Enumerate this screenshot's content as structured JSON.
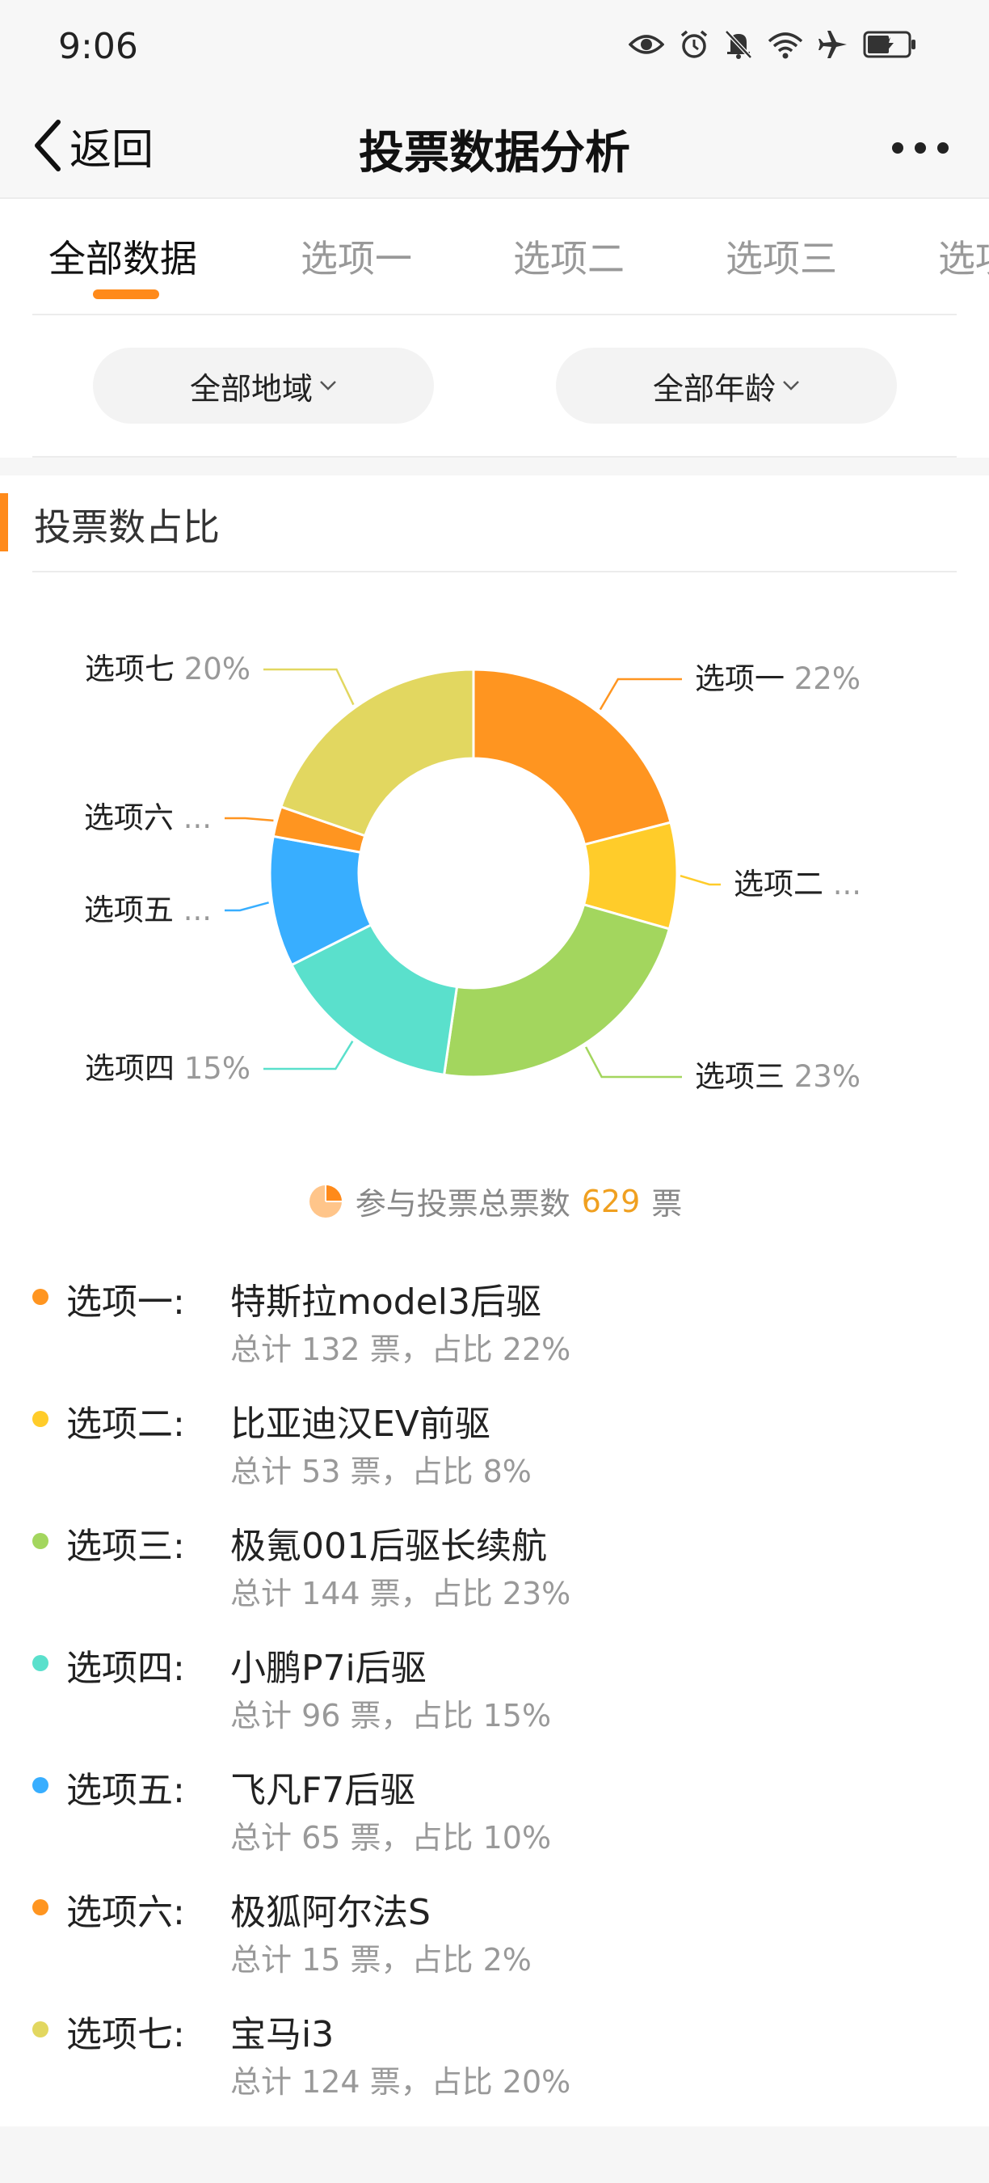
{
  "status_bar": {
    "time": "9:06"
  },
  "nav": {
    "back_label": "返回",
    "title": "投票数据分析"
  },
  "tabs": [
    {
      "label": "全部数据",
      "active": true
    },
    {
      "label": "选项一"
    },
    {
      "label": "选项二"
    },
    {
      "label": "选项三"
    },
    {
      "label": "选项"
    }
  ],
  "filters": {
    "region": "全部地域",
    "age": "全部年龄"
  },
  "section": {
    "title": "投票数占比"
  },
  "summary": {
    "prefix": "参与投票总票数",
    "total": "629",
    "suffix": "票"
  },
  "colors": {
    "accent": "#ff8a1a",
    "total_number": "#f0a020"
  },
  "chart_data": {
    "type": "pie",
    "donut": true,
    "start_angle_deg": 0,
    "slices": [
      {
        "label": "选项一",
        "pct_label": "22%",
        "value": 132,
        "color": "#ff9520",
        "side": "right"
      },
      {
        "label": "选项二",
        "pct_label": "...",
        "value": 53,
        "color": "#ffcc2a",
        "side": "right"
      },
      {
        "label": "选项三",
        "pct_label": "23%",
        "value": 144,
        "color": "#a3d65e",
        "side": "right"
      },
      {
        "label": "选项四",
        "pct_label": "15%",
        "value": 96,
        "color": "#5ae0cc",
        "side": "left"
      },
      {
        "label": "选项五",
        "pct_label": "...",
        "value": 65,
        "color": "#38aeff",
        "side": "left"
      },
      {
        "label": "选项六",
        "pct_label": "...",
        "value": 15,
        "color": "#ff9520",
        "side": "left"
      },
      {
        "label": "选项七",
        "pct_label": "20%",
        "value": 124,
        "color": "#e2d760",
        "side": "left"
      }
    ]
  },
  "legend": [
    {
      "label": "选项一:",
      "name": "特斯拉model3后驱",
      "stats": "总计 132 票，占比 22%",
      "color": "#ff9520"
    },
    {
      "label": "选项二:",
      "name": "比亚迪汉EV前驱",
      "stats": "总计 53 票，占比 8%",
      "color": "#ffcc2a"
    },
    {
      "label": "选项三:",
      "name": "极氪001后驱长续航",
      "stats": "总计 144 票，占比 23%",
      "color": "#a3d65e"
    },
    {
      "label": "选项四:",
      "name": "小鹏P7i后驱",
      "stats": "总计 96 票，占比 15%",
      "color": "#5ae0cc"
    },
    {
      "label": "选项五:",
      "name": "飞凡F7后驱",
      "stats": "总计 65 票，占比 10%",
      "color": "#38aeff"
    },
    {
      "label": "选项六:",
      "name": "极狐阿尔法S",
      "stats": "总计 15 票，占比 2%",
      "color": "#ff9520"
    },
    {
      "label": "选项七:",
      "name": "宝马i3",
      "stats": "总计 124 票，占比 20%",
      "color": "#e2d760"
    }
  ]
}
